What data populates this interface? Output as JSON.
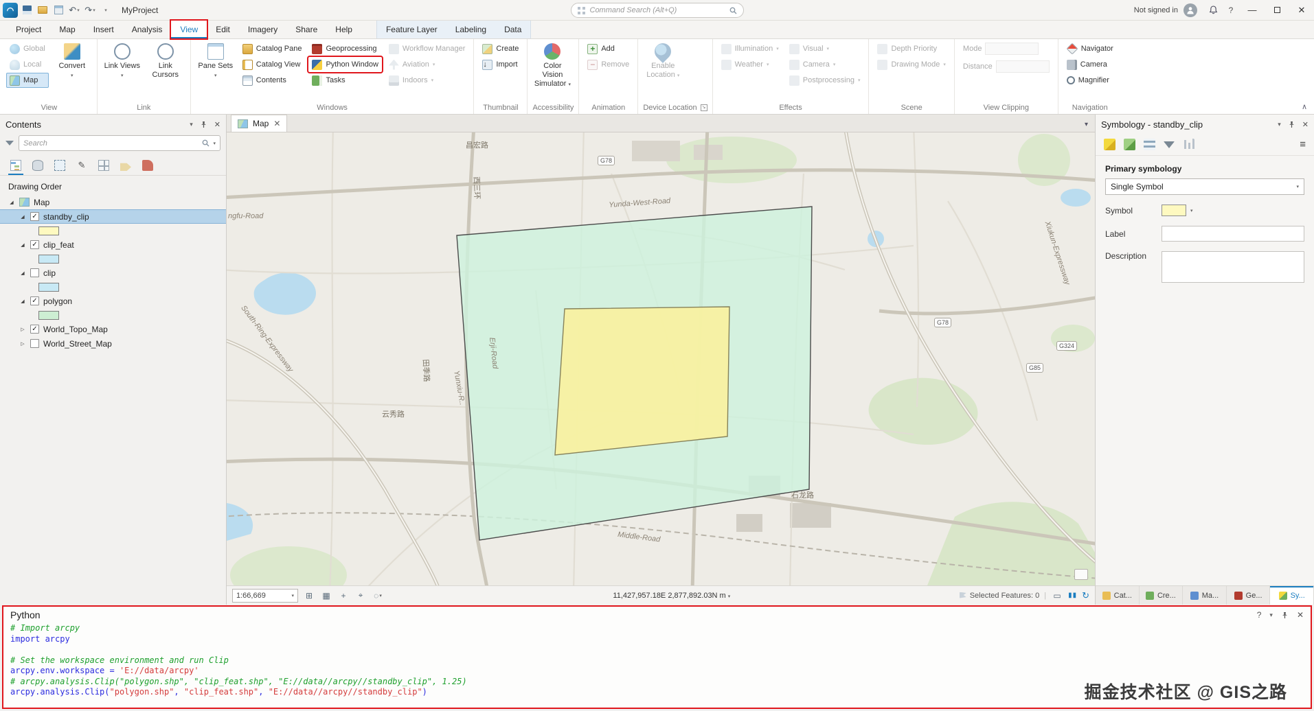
{
  "colors": {
    "accent": "#1a7dc0",
    "annotation": "#e0161c",
    "selection": "#b5d3ea",
    "mint_fill": "#cdf2dd",
    "mint_stroke": "#4a4a4a",
    "poly_yellow": "#f8f1a0",
    "poly_yellow_stroke": "#85815a",
    "swatch_yellow": "#fef9c0",
    "swatch_blue": "#c8e9f5",
    "swatch_green": "#cdeed3",
    "code_comment": "#1fa02e",
    "code_blue": "#2b2bdf",
    "code_string": "#d43c3c"
  },
  "titlebar": {
    "project": "MyProject",
    "search_placeholder": "Command Search (Alt+Q)",
    "signin": "Not signed in"
  },
  "tabs": {
    "project": "Project",
    "map": "Map",
    "insert": "Insert",
    "analysis": "Analysis",
    "view": "View",
    "edit": "Edit",
    "imagery": "Imagery",
    "share": "Share",
    "help": "Help",
    "feature_layer": "Feature Layer",
    "labeling": "Labeling",
    "data": "Data"
  },
  "ribbon": {
    "view": {
      "label": "View",
      "global": "Global",
      "local": "Local",
      "map": "Map",
      "convert": "Convert"
    },
    "link": {
      "label": "Link",
      "views": "Link Views",
      "cursors": "Link Cursors"
    },
    "windows": {
      "label": "Windows",
      "pane_sets": "Pane Sets",
      "catalog_pane": "Catalog Pane",
      "catalog_view": "Catalog View",
      "contents": "Contents",
      "geoprocessing": "Geoprocessing",
      "python_window": "Python Window",
      "tasks": "Tasks",
      "workflow_manager": "Workflow Manager",
      "aviation": "Aviation",
      "indoors": "Indoors"
    },
    "thumbnail": {
      "label": "Thumbnail",
      "create": "Create",
      "import": "Import"
    },
    "accessibility": {
      "label": "Accessibility",
      "cvs": "Color Vision Simulator"
    },
    "animation": {
      "label": "Animation",
      "add": "Add",
      "remove": "Remove"
    },
    "device": {
      "label": "Device Location",
      "enable": "Enable Location"
    },
    "effects": {
      "label": "Effects",
      "illumination": "Illumination",
      "weather": "Weather",
      "visual": "Visual",
      "camera": "Camera",
      "postprocessing": "Postprocessing"
    },
    "scene": {
      "label": "Scene",
      "depth": "Depth Priority",
      "mode": "Drawing Mode"
    },
    "clipping": {
      "label": "View Clipping",
      "mode": "Mode",
      "distance": "Distance"
    },
    "navigation": {
      "label": "Navigation",
      "navigator": "Navigator",
      "camera": "Camera",
      "magnifier": "Magnifier"
    }
  },
  "contents": {
    "title": "Contents",
    "search_placeholder": "Search",
    "section": "Drawing Order",
    "map_item": {
      "name": "Map",
      "expander": "◢"
    },
    "layers": [
      {
        "name": "standby_clip",
        "check": "✓",
        "expander": "◢"
      },
      {
        "name": "clip_feat",
        "check": "✓",
        "expander": "◢"
      },
      {
        "name": "clip",
        "check": "",
        "expander": "◢"
      },
      {
        "name": "polygon",
        "check": "✓",
        "expander": "◢"
      },
      {
        "name": "World_Topo_Map",
        "check": "✓",
        "expander": "▷"
      },
      {
        "name": "World_Street_Map",
        "check": "",
        "expander": "▷"
      }
    ]
  },
  "map": {
    "tab": "Map",
    "scale": "1:66,669",
    "coords": "11,427,957.18E 2,877,892.03N m",
    "selected": "Selected Features: 0",
    "badges": {
      "a": "G78",
      "b": "G78",
      "c": "G324",
      "d": "G85"
    },
    "labels": {
      "changhong": "昌宏路",
      "xisanhuan": "西三环",
      "yunda": "Yunda-West-Road",
      "ngfu": "ngfu-Road",
      "southring": "South-Ring-Expressway",
      "erji": "Erji-Road",
      "tianji": "田季路",
      "yunxiu_r": "Yunxiu-R..",
      "yunxiu": "云秀路",
      "shilong": "石龙路",
      "middle": "Middle-Road",
      "xiukun": "Xiukun-Expressway"
    }
  },
  "symbology": {
    "title": "Symbology - standby_clip",
    "primary": "Primary symbology",
    "primary_value": "Single Symbol",
    "symbol": "Symbol",
    "label": "Label",
    "description": "Description"
  },
  "dock_tabs": {
    "cat": "Cat...",
    "cre": "Cre...",
    "ma": "Ma...",
    "ge": "Ge...",
    "sy": "Sy..."
  },
  "python": {
    "title": "Python",
    "l1": "# Import arcpy",
    "l2a": "import ",
    "l2b": "arcpy",
    "l4": "# Set the workspace environment and run Clip",
    "l5a": "arcpy.env.workspace = ",
    "l5b": "'E://data/arcpy'",
    "l6": "# arcpy.analysis.Clip(\"polygon.shp\", \"clip_feat.shp\", \"E://data//arcpy//standby_clip\", 1.25)",
    "l7a": "arcpy.analysis.Clip(",
    "l7b": "\"polygon.shp\"",
    "l7c": ", ",
    "l7d": "\"clip_feat.shp\"",
    "l7e": ", ",
    "l7f": "\"E://data//arcpy//standby_clip\"",
    "l7g": ")"
  },
  "watermark": "掘金技术社区 @ GIS之路"
}
